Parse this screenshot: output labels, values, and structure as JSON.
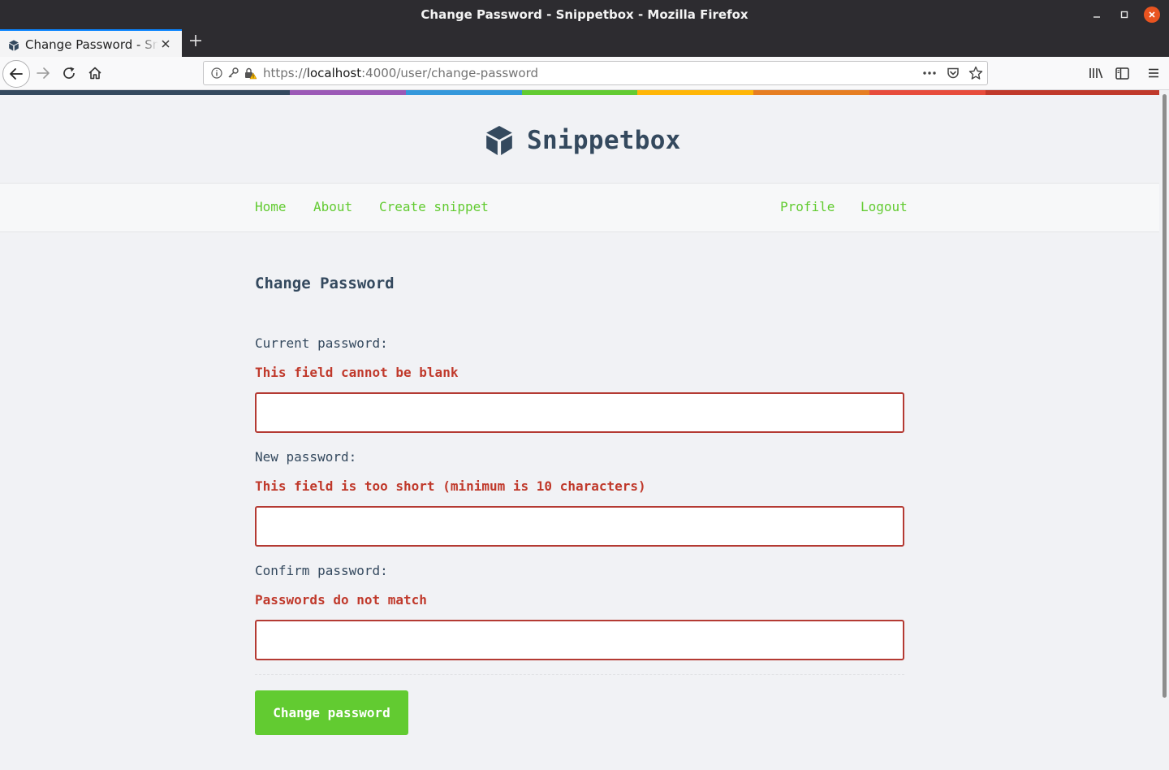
{
  "window": {
    "title": "Change Password - Snippetbox - Mozilla Firefox",
    "minimize_icon": "minimize-icon",
    "maximize_icon": "maximize-icon",
    "close_icon": "close-icon"
  },
  "tabs": [
    {
      "label": "Change Password - Snippetbox",
      "active": true,
      "favicon": "snippetbox-cube-icon"
    }
  ],
  "new_tab_icon": "plus-icon",
  "toolbar": {
    "url_prefix": "https://",
    "url_host": "localhost",
    "url_rest": ":4000/user/change-password",
    "icons": [
      "back-arrow-icon",
      "forward-arrow-icon",
      "reload-icon",
      "home-icon",
      "info-icon",
      "key-icon",
      "insecure-lock-icon",
      "more-actions-icon",
      "pocket-icon",
      "bookmark-star-icon",
      "library-icon",
      "sidebar-icon",
      "hamburger-menu-icon"
    ]
  },
  "site": {
    "brand": "Snippetbox",
    "accent_color": "#62cb31",
    "heading_color": "#34495e",
    "error_color": "#c0392b",
    "rainbow_colors": [
      "#34495e",
      "#9b59b6",
      "#3498db",
      "#62cb31",
      "#ffb606",
      "#e67e22",
      "#e74c3c",
      "#c0392b"
    ]
  },
  "nav": {
    "home": "Home",
    "about": "About",
    "create_snippet": "Create snippet",
    "profile": "Profile",
    "logout": "Logout"
  },
  "form": {
    "heading": "Change Password",
    "current": {
      "label": "Current password:",
      "error": "This field cannot be blank",
      "value": ""
    },
    "new": {
      "label": "New password:",
      "error": "This field is too short (minimum is 10 characters)",
      "value": ""
    },
    "confirm": {
      "label": "Confirm password:",
      "error": "Passwords do not match",
      "value": ""
    },
    "submit_label": "Change password"
  }
}
